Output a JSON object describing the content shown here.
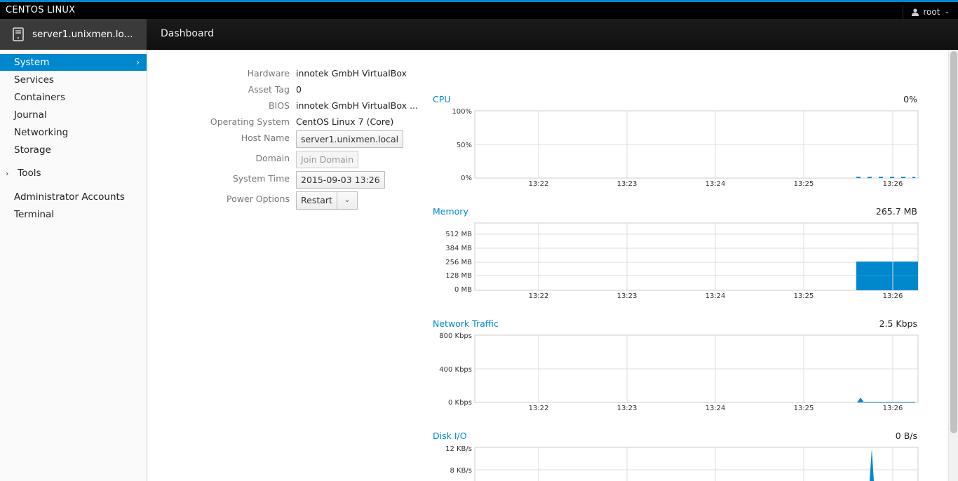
{
  "topbar": {
    "brand": "CENTOS LINUX",
    "user": "root",
    "user_icon": "user-icon",
    "dropdown_icon": "chevron-down-icon"
  },
  "navbar": {
    "host": "server1.unixmen.lo...",
    "host_icon": "server-icon",
    "title": "Dashboard"
  },
  "sidebar": {
    "items": [
      {
        "label": "System",
        "active": true
      },
      {
        "label": "Services"
      },
      {
        "label": "Containers"
      },
      {
        "label": "Journal"
      },
      {
        "label": "Networking"
      },
      {
        "label": "Storage"
      },
      {
        "label": "Tools"
      },
      {
        "label": "Administrator Accounts"
      },
      {
        "label": "Terminal"
      }
    ]
  },
  "info": {
    "hardware_label": "Hardware",
    "hardware": "innotek GmbH VirtualBox",
    "asset_tag_label": "Asset Tag",
    "asset_tag": "0",
    "bios_label": "BIOS",
    "bios": "innotek GmbH VirtualBox ...",
    "os_label": "Operating System",
    "os": "CentOS Linux 7 (Core)",
    "hostname_label": "Host Name",
    "hostname": "server1.unixmen.local",
    "domain_label": "Domain",
    "domain_button": "Join Domain",
    "time_label": "System Time",
    "time": "2015-09-03 13:26",
    "power_label": "Power Options",
    "power_button": "Restart"
  },
  "graphs": {
    "time_ticks": [
      "13:22",
      "13:23",
      "13:24",
      "13:25",
      "13:26"
    ],
    "cpu": {
      "title": "CPU",
      "value": "0%",
      "y_ticks": [
        "100%",
        "50%",
        "0%"
      ]
    },
    "memory": {
      "title": "Memory",
      "value": "265.7 MB",
      "y_ticks": [
        "512 MB",
        "384 MB",
        "256 MB",
        "128 MB",
        "0 MB"
      ]
    },
    "network": {
      "title": "Network Traffic",
      "value": "2.5 Kbps",
      "y_ticks": [
        "800 Kbps",
        "400 Kbps",
        "0 Kbps"
      ]
    },
    "disk": {
      "title": "Disk I/O",
      "value": "0 B/s",
      "y_ticks": [
        "12 KB/s",
        "8 KB/s"
      ]
    }
  },
  "colors": {
    "accent": "#0088ce",
    "topbar": "#000000",
    "sidebar_active": "#0088ce"
  }
}
